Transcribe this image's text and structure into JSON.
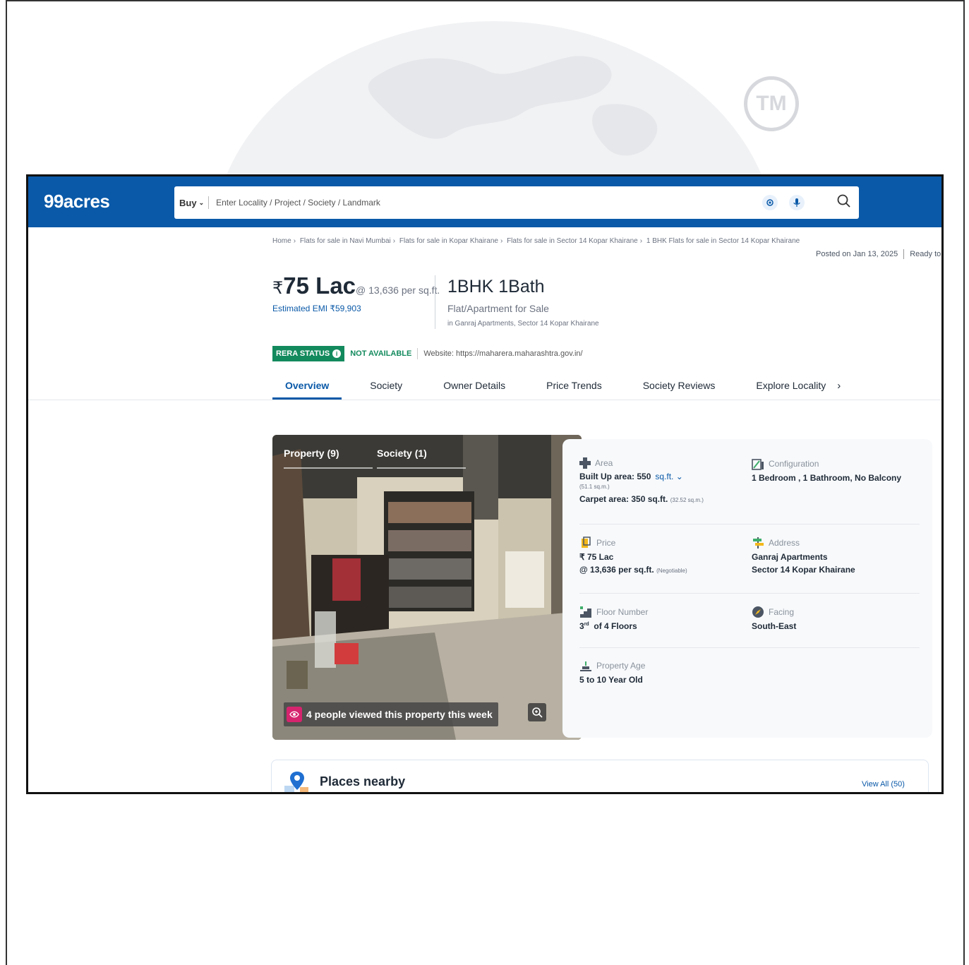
{
  "watermark": {
    "tm_text": "TM"
  },
  "header": {
    "logo": "99acres",
    "buy_label": "Buy",
    "search_placeholder": "Enter Locality / Project / Society / Landmark"
  },
  "breadcrumb": [
    "Home",
    "Flats for sale in Navi Mumbai",
    "Flats for sale in Kopar Khairane",
    "Flats for sale in Sector 14 Kopar Khairane",
    "1 BHK Flats for sale in Sector 14 Kopar Khairane"
  ],
  "posted": {
    "date": "Posted on Jan 13, 2025",
    "status": "Ready to m"
  },
  "price": {
    "rupee": "₹",
    "amount": "75 Lac",
    "per_sqft": "@ 13,636 per sq.ft.",
    "emi": "Estimated EMI ₹59,903"
  },
  "config": {
    "title": "1BHK 1Bath",
    "type": "Flat/Apartment for Sale",
    "location": "in Ganraj Apartments, Sector 14 Kopar Khairane"
  },
  "rera": {
    "badge": "RERA STATUS",
    "status": "NOT AVAILABLE",
    "website": "Website: https://maharera.maharashtra.gov.in/"
  },
  "tabs": [
    "Overview",
    "Society",
    "Owner Details",
    "Price Trends",
    "Society Reviews",
    "Explore Locality"
  ],
  "gallery": {
    "tab_property": "Property (9)",
    "tab_society": "Society (1)",
    "views_text": "4 people viewed this property this week"
  },
  "details": {
    "area": {
      "label": "Area",
      "built_up": "Built Up area: 550",
      "unit": "sq.ft.",
      "built_sqm": "(51.1 sq.m.)",
      "carpet": "Carpet area: 350 sq.ft.",
      "carpet_sqm": "(32.52 sq.m.)"
    },
    "configuration": {
      "label": "Configuration",
      "value": "1 Bedroom , 1 Bathroom, No Balcony"
    },
    "price": {
      "label": "Price",
      "value": "₹ 75 Lac",
      "per": "@ 13,636 per sq.ft.",
      "negotiable": "(Negotiable)"
    },
    "address": {
      "label": "Address",
      "line1": "Ganraj Apartments",
      "line2": "Sector 14 Kopar Khairane"
    },
    "floor": {
      "label": "Floor Number",
      "floor": "3",
      "sup": "rd",
      "of": "of 4 Floors"
    },
    "facing": {
      "label": "Facing",
      "value": "South-East"
    },
    "age": {
      "label": "Property Age",
      "value": "5 to 10 Year Old"
    }
  },
  "places": {
    "title": "Places nearby",
    "view_all": "View All (50)"
  },
  "colors": {
    "brand": "#0a59a8",
    "rera_green": "#138a5e",
    "views_pink": "#d6246e"
  }
}
